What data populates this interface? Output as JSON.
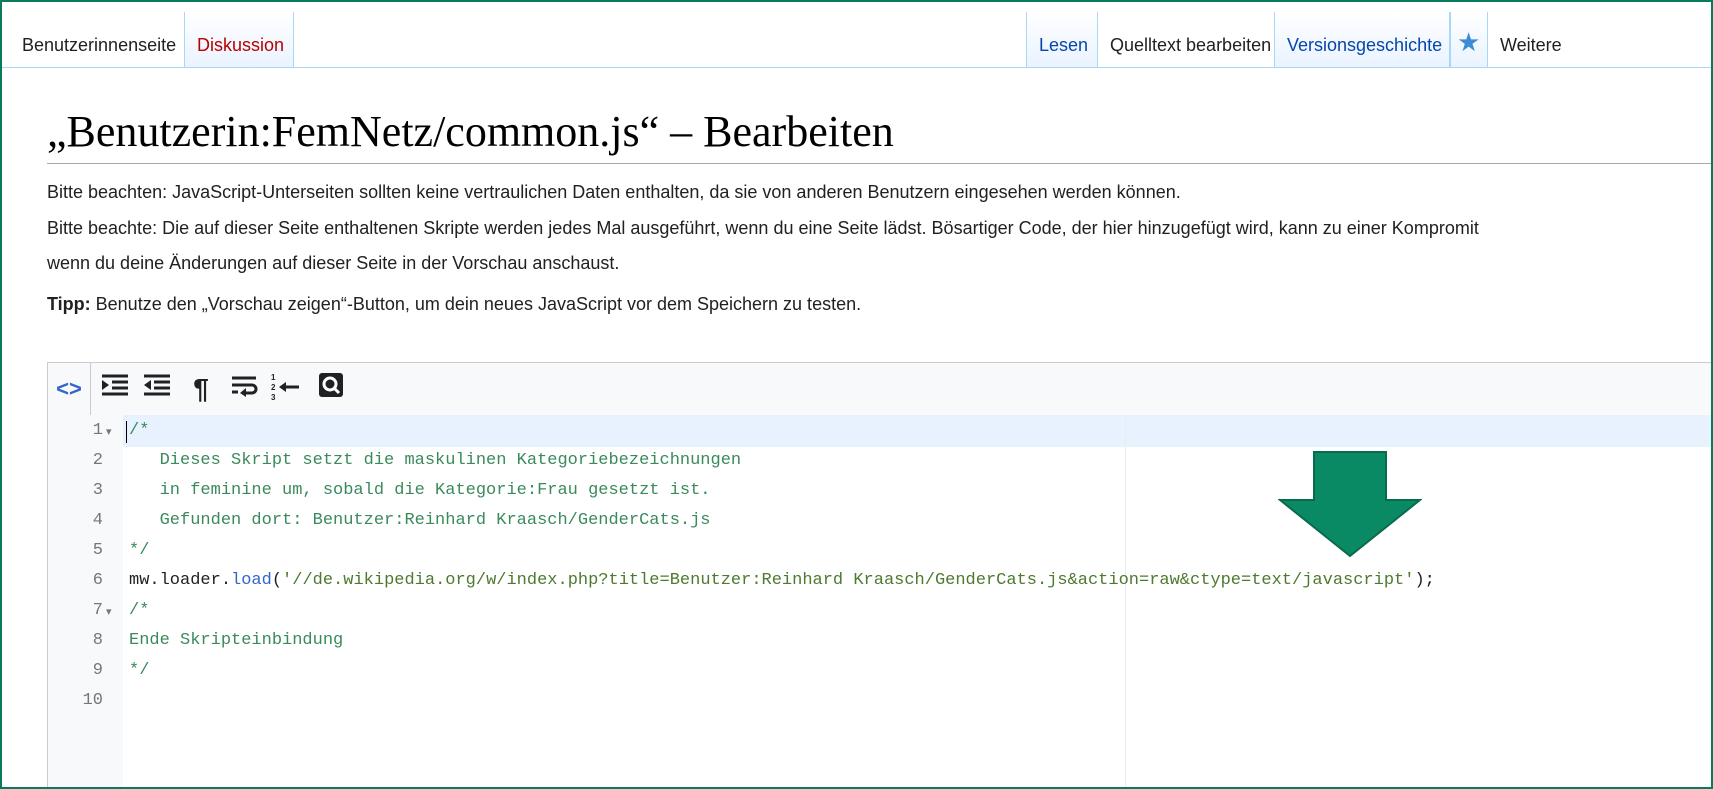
{
  "tabs": {
    "user_page": "Benutzerinnenseite",
    "discussion": "Diskussion",
    "read": "Lesen",
    "edit_source": "Quelltext bearbeiten",
    "history": "Versionsgeschichte",
    "more": "Weitere"
  },
  "page": {
    "title": "„Benutzerin:FemNetz/common.js“ – Bearbeiten",
    "notice1": "Bitte beachten: JavaScript-Unterseiten sollten keine vertraulichen Daten enthalten, da sie von anderen Benutzern eingesehen werden können.",
    "notice2": "Bitte beachte: Die auf dieser Seite enthaltenen Skripte werden jedes Mal ausgeführt, wenn du eine Seite lädst. Bösartiger Code, der hier hinzugefügt wird, kann zu einer Kompromit",
    "notice3": "wenn du deine Änderungen auf dieser Seite in der Vorschau anschaust.",
    "tip_label": "Tipp:",
    "tip_text": " Benutze den „Vorschau zeigen“-Button, um dein neues JavaScript vor dem Speichern zu testen."
  },
  "toolbar": {
    "icons": [
      "code-toggle-icon",
      "indent-icon",
      "outdent-icon",
      "pilcrow-icon",
      "line-wrap-icon",
      "goto-line-icon",
      "search-replace-icon"
    ],
    "glyphs": {
      "code": "<>",
      "indent": "⇥",
      "outdent": "⇤",
      "pilcrow": "¶",
      "wrap": "↵",
      "goto": "←",
      "search": "⌕"
    }
  },
  "code": {
    "line_numbers": [
      "1",
      "2",
      "3",
      "4",
      "5",
      "6",
      "7",
      "8",
      "9",
      "10"
    ],
    "lines": [
      "/*",
      "   Dieses Skript setzt die maskulinen Kategoriebezeichnungen",
      "   in feminine um, sobald die Kategorie:Frau gesetzt ist.",
      "   Gefunden dort: Benutzer:Reinhard Kraasch/GenderCats.js",
      "*/",
      "mw.loader.",
      "load",
      "(",
      "'//de.wikipedia.org/w/index.php?title=Benutzer:Reinhard Kraasch/GenderCats.js&action=raw&ctype=text/javascript'",
      ");",
      "/*",
      "Ende Skripteinbindung",
      "*/",
      ""
    ]
  },
  "colors": {
    "frame": "#0a7a5c",
    "arrow": "#0a7a5c",
    "link": "#0645ad",
    "red_link": "#ba0000"
  }
}
